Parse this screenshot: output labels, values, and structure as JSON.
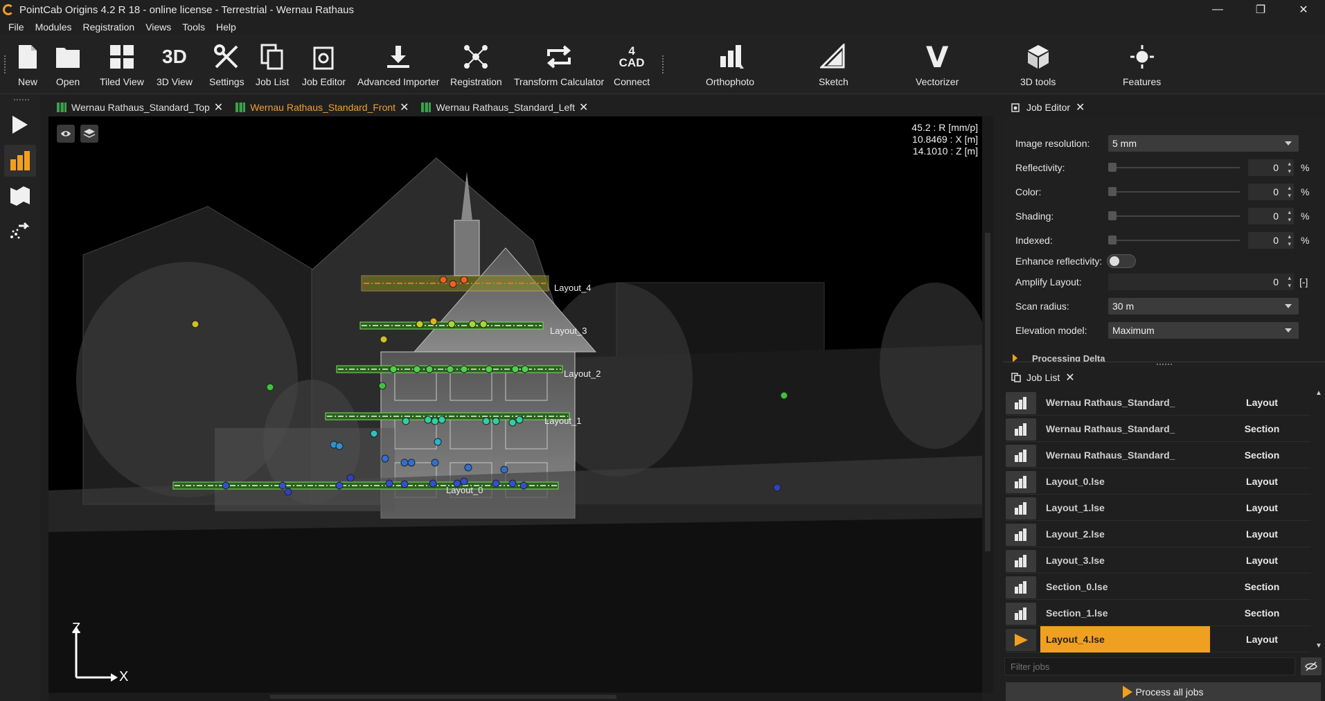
{
  "window": {
    "title": "PointCab Origins 4.2 R 18 - online license - Terrestrial - Wernau Rathaus"
  },
  "menu": [
    "File",
    "Modules",
    "Registration",
    "Views",
    "Tools",
    "Help"
  ],
  "toolbar": {
    "new": "New",
    "open": "Open",
    "tiled_view": "Tiled View",
    "view_3d": "3D View",
    "view_3d_glyph": "3D",
    "settings": "Settings",
    "job_list": "Job List",
    "job_editor": "Job Editor",
    "advanced_importer": "Advanced Importer",
    "registration": "Registration",
    "transform_calculator": "Transform Calculator",
    "connect": "Connect",
    "connect_glyph_top": "4",
    "connect_glyph_bottom": "CAD",
    "orthophoto": "Orthophoto",
    "sketch": "Sketch",
    "vectorizer": "Vectorizer",
    "vectorizer_glyph": "V",
    "tools_3d": "3D tools",
    "features": "Features"
  },
  "tabs": [
    {
      "label": "Wernau Rathaus_Standard_Top"
    },
    {
      "label": "Wernau Rathaus_Standard_Front"
    },
    {
      "label": "Wernau Rathaus_Standard_Left"
    }
  ],
  "viewport": {
    "readout": [
      "45.2 : R [mm/p]",
      "10.8469 : X [m]",
      "14.1010 : Z [m]"
    ],
    "layout_labels": [
      "Layout_4",
      "Layout_3",
      "Layout_2",
      "Layout_1",
      "Layout_0"
    ],
    "axis_z": "Z",
    "axis_x": "X"
  },
  "job_editor": {
    "title": "Job Editor",
    "image_resolution_label": "Image resolution:",
    "image_resolution_value": "5 mm",
    "reflectivity_label": "Reflectivity:",
    "reflectivity_value": "0",
    "color_label": "Color:",
    "color_value": "0",
    "shading_label": "Shading:",
    "shading_value": "0",
    "indexed_label": "Indexed:",
    "indexed_value": "0",
    "percent": "%",
    "enhance_label": "Enhance reflectivity:",
    "amplify_label": "Amplify Layout:",
    "amplify_value": "0",
    "amplify_unit": "[-]",
    "scan_radius_label": "Scan radius:",
    "scan_radius_value": "30 m",
    "elevation_label": "Elevation model:",
    "elevation_value": "Maximum",
    "section_label": "Processing Delta"
  },
  "job_list": {
    "title": "Job List",
    "rows": [
      {
        "name": "Wernau Rathaus_Standard_",
        "type": "Layout"
      },
      {
        "name": "Wernau Rathaus_Standard_",
        "type": "Section"
      },
      {
        "name": "Wernau Rathaus_Standard_",
        "type": "Section"
      },
      {
        "name": "Layout_0.lse",
        "type": "Layout"
      },
      {
        "name": "Layout_1.lse",
        "type": "Layout"
      },
      {
        "name": "Layout_2.lse",
        "type": "Layout"
      },
      {
        "name": "Layout_3.lse",
        "type": "Layout"
      },
      {
        "name": "Section_0.lse",
        "type": "Section"
      },
      {
        "name": "Section_1.lse",
        "type": "Section"
      },
      {
        "name": "Layout_4.lse",
        "type": "Layout"
      }
    ],
    "filter_placeholder": "Filter jobs",
    "process_all": "Process all jobs"
  }
}
